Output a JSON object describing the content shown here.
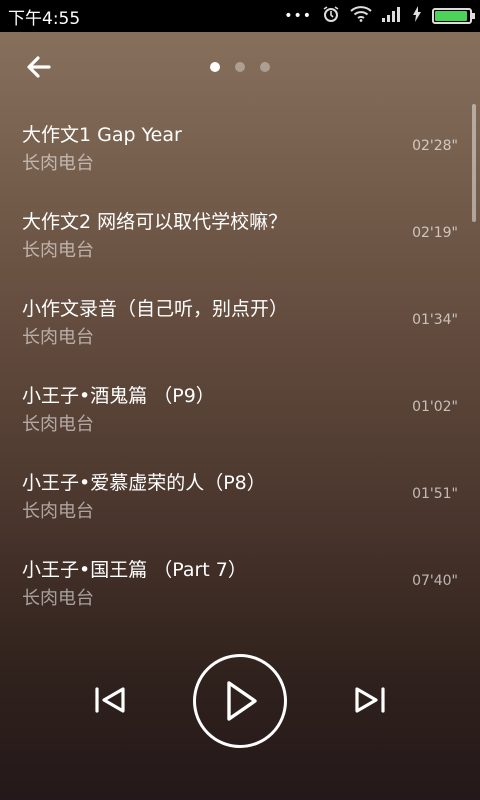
{
  "status": {
    "time": "下午4:55",
    "icons": [
      "more-dots-icon",
      "alarm-icon",
      "wifi-icon",
      "signal-icon",
      "charging-icon",
      "battery-icon"
    ]
  },
  "nav": {
    "back_icon": "arrow-left-icon",
    "pages": 3,
    "active_page": 1
  },
  "tracks": [
    {
      "title": "大作文1 Gap Year",
      "artist": "长肉电台",
      "duration": "02'28\""
    },
    {
      "title": "大作文2 网络可以取代学校嘛？",
      "artist": "长肉电台",
      "duration": "02'19\""
    },
    {
      "title": "小作文录音（自己听，别点开）",
      "artist": "长肉电台",
      "duration": "01'34\""
    },
    {
      "title": "小王子•酒鬼篇 （P9）",
      "artist": "长肉电台",
      "duration": "01'02\""
    },
    {
      "title": "小王子•爱慕虚荣的人（P8）",
      "artist": "长肉电台",
      "duration": "01'51\""
    },
    {
      "title": "小王子•国王篇 （Part 7）",
      "artist": "长肉电台",
      "duration": "07'40\""
    }
  ],
  "player": {
    "prev_icon": "skip-previous-icon",
    "play_icon": "play-icon",
    "next_icon": "skip-next-icon"
  },
  "colors": {
    "accent": "#4cd35a",
    "background_top": "#8a745f",
    "background_bottom": "#24181a"
  }
}
